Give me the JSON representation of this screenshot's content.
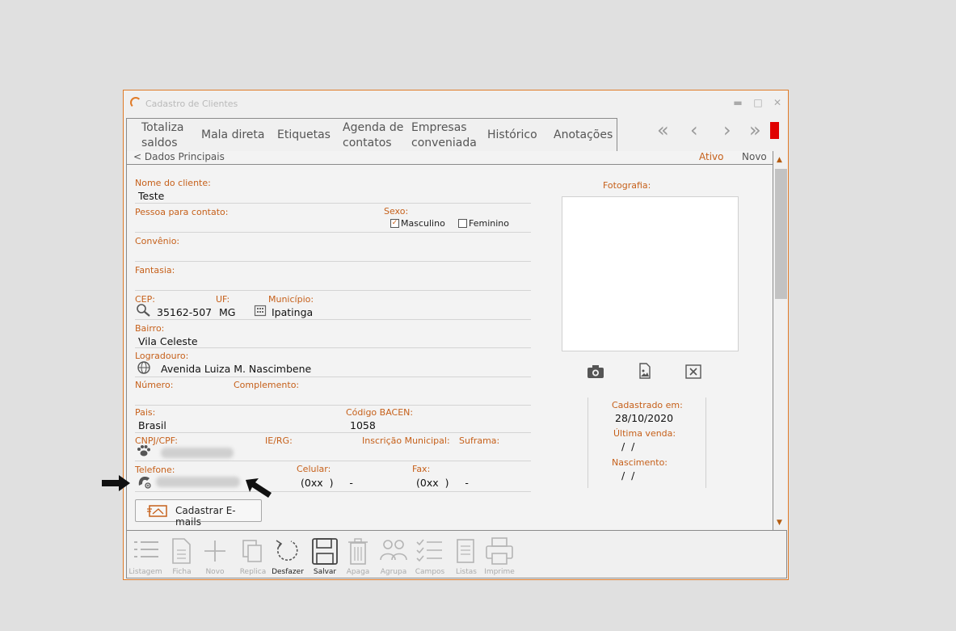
{
  "window": {
    "title": "Cadastro de Clientes",
    "minimize_glyph": "▬",
    "maximize_glyph": "□",
    "close_glyph": "✕"
  },
  "menu": {
    "items": [
      {
        "line1": "Totaliza",
        "line2": "saldos"
      },
      {
        "line1": "Mala direta",
        "line2": ""
      },
      {
        "line1": "Etiquetas",
        "line2": ""
      },
      {
        "line1": "Agenda de",
        "line2": "contatos"
      },
      {
        "line1": "Empresas",
        "line2": "conveniada"
      },
      {
        "line1": "Histórico",
        "line2": ""
      },
      {
        "line1": "Anotações",
        "line2": ""
      }
    ]
  },
  "nav": {
    "first": "«",
    "prev": "‹",
    "next": "›",
    "last": "»"
  },
  "section": {
    "title": "< Dados Principais",
    "status": "Ativo",
    "mode": "Novo"
  },
  "form": {
    "nome_label": "Nome do cliente:",
    "nome_value": "Teste",
    "contato_label": "Pessoa para contato:",
    "sexo_label": "Sexo:",
    "masculino": "Masculino",
    "feminino": "Feminino",
    "check_mark": "✓",
    "convenio_label": "Convênio:",
    "fantasia_label": "Fantasia:",
    "cep_label": "CEP:",
    "cep_value": "35162-507",
    "uf_label": "UF:",
    "uf_value": "MG",
    "municipio_label": "Município:",
    "municipio_value": "Ipatinga",
    "bairro_label": "Bairro:",
    "bairro_value": "Vila Celeste",
    "logradouro_label": "Logradouro:",
    "logradouro_value": "Avenida Luiza M. Nascimbene",
    "numero_label": "Número:",
    "complemento_label": "Complemento:",
    "pais_label": "Pais:",
    "pais_value": "Brasil",
    "bacen_label": "Código BACEN:",
    "bacen_value": "1058",
    "cnpj_label": "CNPJ/CPF:",
    "ie_label": "IE/RG:",
    "inscricao_label": "Inscrição Municipal:",
    "suframa_label": "Suframa:",
    "telefone_label": "Telefone:",
    "celular_label": "Celular:",
    "celular_value": "(0xx  )     -",
    "fax_label": "Fax:",
    "fax_value": "(0xx  )     -"
  },
  "photo": {
    "label": "Fotografia:"
  },
  "dates": {
    "cadastrado_label": "Cadastrado em:",
    "cadastrado_value": "28/10/2020",
    "ultima_label": "Última venda:",
    "ultima_value": " /  /",
    "nascimento_label": "Nascimento:",
    "nascimento_value": " /  /"
  },
  "cadastrar_emails": "Cadastrar E-mails",
  "toolbar": [
    {
      "label": "Listagem",
      "active": false
    },
    {
      "label": "Ficha",
      "active": false
    },
    {
      "label": "Novo",
      "active": false
    },
    {
      "label": "Replica",
      "active": false
    },
    {
      "label": "Desfazer",
      "active": true
    },
    {
      "label": "Salvar",
      "active": true
    },
    {
      "label": "Apaga",
      "active": false
    },
    {
      "label": "Agrupa",
      "active": false
    },
    {
      "label": "Campos",
      "active": false
    },
    {
      "label": "Listas",
      "active": false
    },
    {
      "label": "Imprime",
      "active": false
    }
  ],
  "colors": {
    "accent": "#e07b28",
    "label": "#c6601a",
    "flag": "#e00000"
  }
}
